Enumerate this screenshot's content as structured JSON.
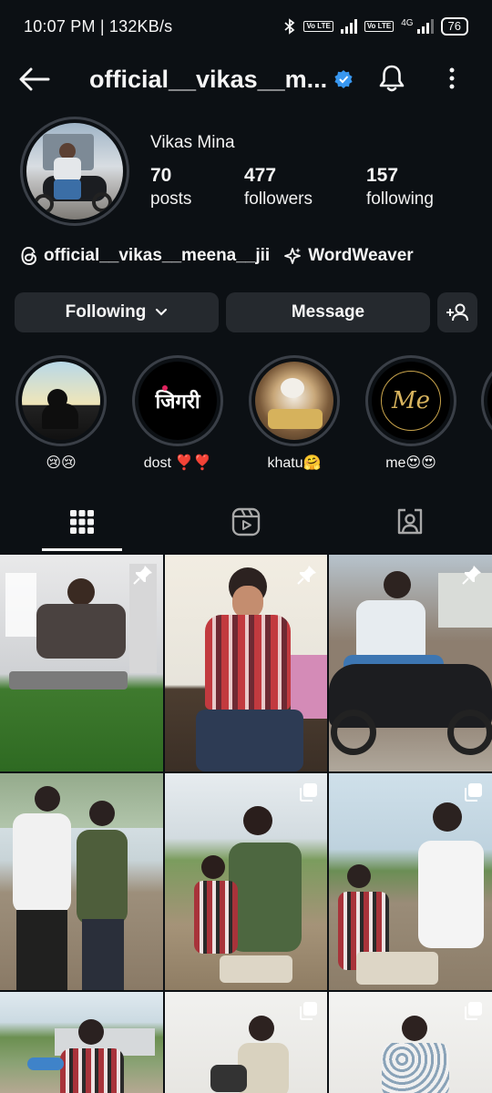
{
  "status": {
    "time": "10:07 PM | 132KB/s",
    "volte1": "Vo LTE",
    "volte2": "Vo LTE",
    "net": "4G",
    "battery": "76"
  },
  "header": {
    "username": "official__vikas__m...",
    "verified": true
  },
  "profile": {
    "full_name": "Vikas Mina",
    "stats": [
      {
        "value": "70",
        "label": "posts"
      },
      {
        "value": "477",
        "label": "followers"
      },
      {
        "value": "157",
        "label": "following"
      }
    ],
    "threads_handle": "official__vikas__meena__jii",
    "wordweaver": "WordWeaver"
  },
  "actions": {
    "following": "Following",
    "message": "Message"
  },
  "highlights": [
    {
      "label": "😢😢"
    },
    {
      "label": "dost ❣️❣️",
      "inner_text": "जिगरी"
    },
    {
      "label": "khatu🤗"
    },
    {
      "label": "me😍😍",
      "inner_text": "Me"
    }
  ],
  "colors": {
    "background": "#0c1014",
    "button": "#25292e",
    "verified": "#3897f0"
  },
  "icons": [
    "back-arrow-icon",
    "verified-badge-icon",
    "bell-icon",
    "more-vertical-icon",
    "threads-icon",
    "sparkle-icon",
    "chevron-down-icon",
    "add-person-icon",
    "grid-icon",
    "reels-icon",
    "tagged-icon",
    "pin-icon",
    "multiple-photos-icon"
  ]
}
